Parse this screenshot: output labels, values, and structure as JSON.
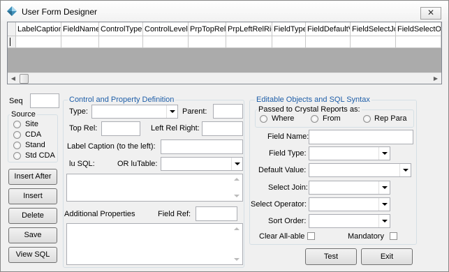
{
  "window": {
    "title": "User Form Designer",
    "close_label": "✕"
  },
  "grid": {
    "columns": [
      "LabelCaption",
      "FieldName",
      "ControlType",
      "ControlLevel",
      "PrpTopRel",
      "PrpLeftRelRig",
      "FieldType",
      "FieldDefaultV",
      "FieldSelectJo",
      "FieldSelectOp"
    ]
  },
  "left": {
    "seq_label": "Seq",
    "source_title": "Source",
    "source_options": [
      "Site",
      "CDA",
      "Stand",
      "Std CDA"
    ],
    "buttons": {
      "insert_after": "Insert After",
      "insert": "Insert",
      "delete": "Delete",
      "save": "Save",
      "view_sql": "View SQL"
    }
  },
  "control_def": {
    "title": "Control and Property Definition",
    "type_label": "Type:",
    "parent_label": "Parent:",
    "top_rel_label": "Top Rel:",
    "left_rel_label": "Left Rel Right:",
    "label_caption_label": "Label Caption (to the left):",
    "lu_sql_label": "lu SQL:",
    "or_lutable_label": "OR luTable:",
    "additional_label": "Additional Properties",
    "field_ref_label": "Field Ref:"
  },
  "editable": {
    "title": "Editable Objects and SQL Syntax",
    "passed_title": "Passed to Crystal Reports as:",
    "passed_options": [
      "Where",
      "From",
      "Rep Para"
    ],
    "field_name_label": "Field Name:",
    "field_type_label": "Field Type:",
    "default_value_label": "Default Value:",
    "select_join_label": "Select Join:",
    "select_operator_label": "Select Operator:",
    "sort_order_label": "Sort Order:",
    "clear_all_label": "Clear All-able",
    "mandatory_label": "Mandatory"
  },
  "footer": {
    "test": "Test",
    "exit": "Exit"
  }
}
